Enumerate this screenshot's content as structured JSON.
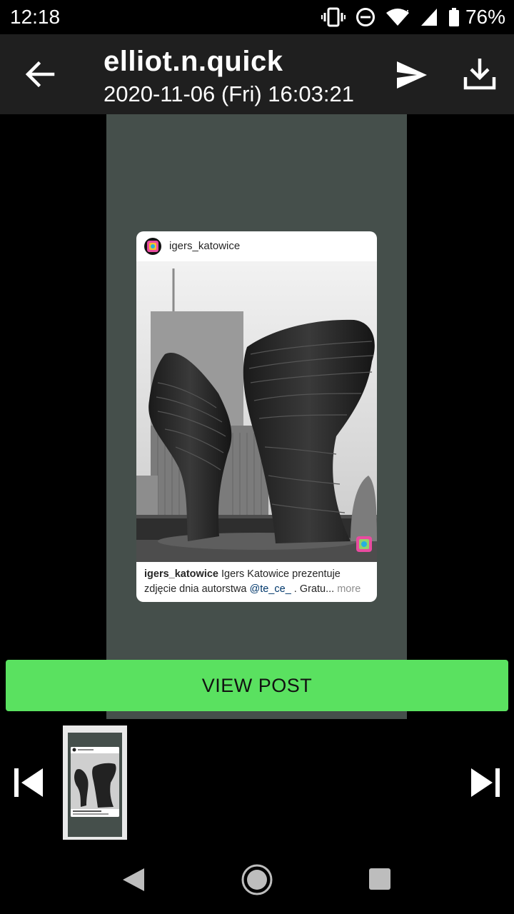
{
  "status_bar": {
    "time": "12:18",
    "battery_percent": "76%",
    "icons": [
      "vibrate-icon",
      "do-not-disturb-icon",
      "wifi-icon",
      "signal-icon",
      "battery-icon"
    ]
  },
  "app_bar": {
    "title": "elliot.n.quick",
    "subtitle": "2020-11-06 (Fri) 16:03:21",
    "icons": [
      "back-arrow-icon",
      "send-icon",
      "download-icon"
    ]
  },
  "post": {
    "username": "igers_katowice",
    "caption_user": "igers_katowice",
    "caption_text": " Igers Katowice prezentuje zdjęcie dnia autorstwa ",
    "caption_mention": "@te_ce_",
    "caption_tail": " . Gratu...",
    "caption_more": " more"
  },
  "actions": {
    "view_post_label": "VIEW POST"
  },
  "colors": {
    "accent": "#5ae160",
    "app_bar": "#1f1f1f",
    "preview_bg": "#454f4b"
  },
  "navigation": {
    "icons": [
      "skip-previous-icon",
      "skip-next-icon",
      "nav-back-icon",
      "nav-home-icon",
      "nav-recents-icon"
    ]
  }
}
